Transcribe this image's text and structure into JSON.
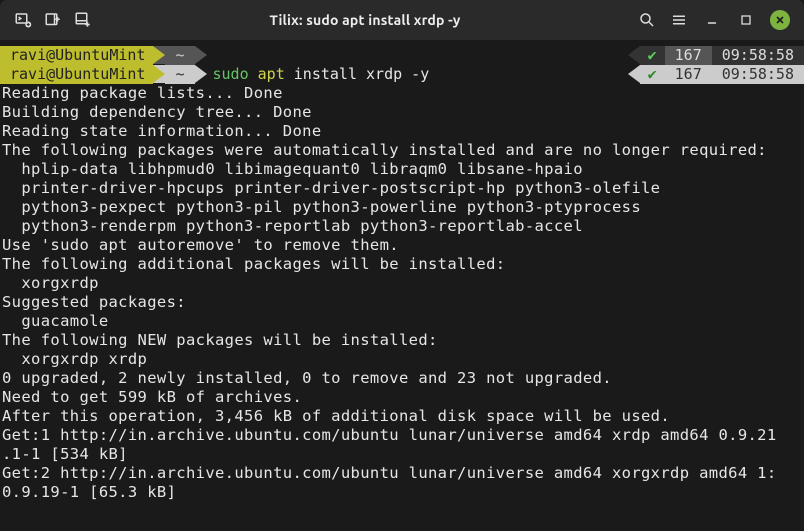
{
  "titlebar": {
    "title": "Tilix: sudo apt install xrdp -y"
  },
  "prompt1": {
    "userhost": "ravi@UbuntuMint",
    "tilde": "~",
    "cmd_empty": "",
    "check": "✔",
    "num": "167",
    "time": "09:58:58"
  },
  "prompt2": {
    "userhost": "ravi@UbuntuMint",
    "tilde": "~",
    "cmd_sudo": "sudo",
    "cmd_apt": "apt",
    "cmd_rest": " install xrdp -y",
    "check": "✔",
    "num": "167",
    "time": "09:58:58"
  },
  "output": {
    "l1": "Reading package lists... Done",
    "l2": "Building dependency tree... Done",
    "l3": "Reading state information... Done",
    "l4": "The following packages were automatically installed and are no longer required:",
    "l5": "  hplip-data libhpmud0 libimagequant0 libraqm0 libsane-hpaio",
    "l6": "  printer-driver-hpcups printer-driver-postscript-hp python3-olefile",
    "l7": "  python3-pexpect python3-pil python3-powerline python3-ptyprocess",
    "l8": "  python3-renderpm python3-reportlab python3-reportlab-accel",
    "l9": "Use 'sudo apt autoremove' to remove them.",
    "l10": "The following additional packages will be installed:",
    "l11": "  xorgxrdp",
    "l12": "Suggested packages:",
    "l13": "  guacamole",
    "l14": "The following NEW packages will be installed:",
    "l15": "  xorgxrdp xrdp",
    "l16": "0 upgraded, 2 newly installed, 0 to remove and 23 not upgraded.",
    "l17": "Need to get 599 kB of archives.",
    "l18": "After this operation, 3,456 kB of additional disk space will be used.",
    "l19": "Get:1 http://in.archive.ubuntu.com/ubuntu lunar/universe amd64 xrdp amd64 0.9.21",
    "l20": ".1-1 [534 kB]",
    "l21": "Get:2 http://in.archive.ubuntu.com/ubuntu lunar/universe amd64 xorgxrdp amd64 1:",
    "l22": "0.9.19-1 [65.3 kB]"
  }
}
